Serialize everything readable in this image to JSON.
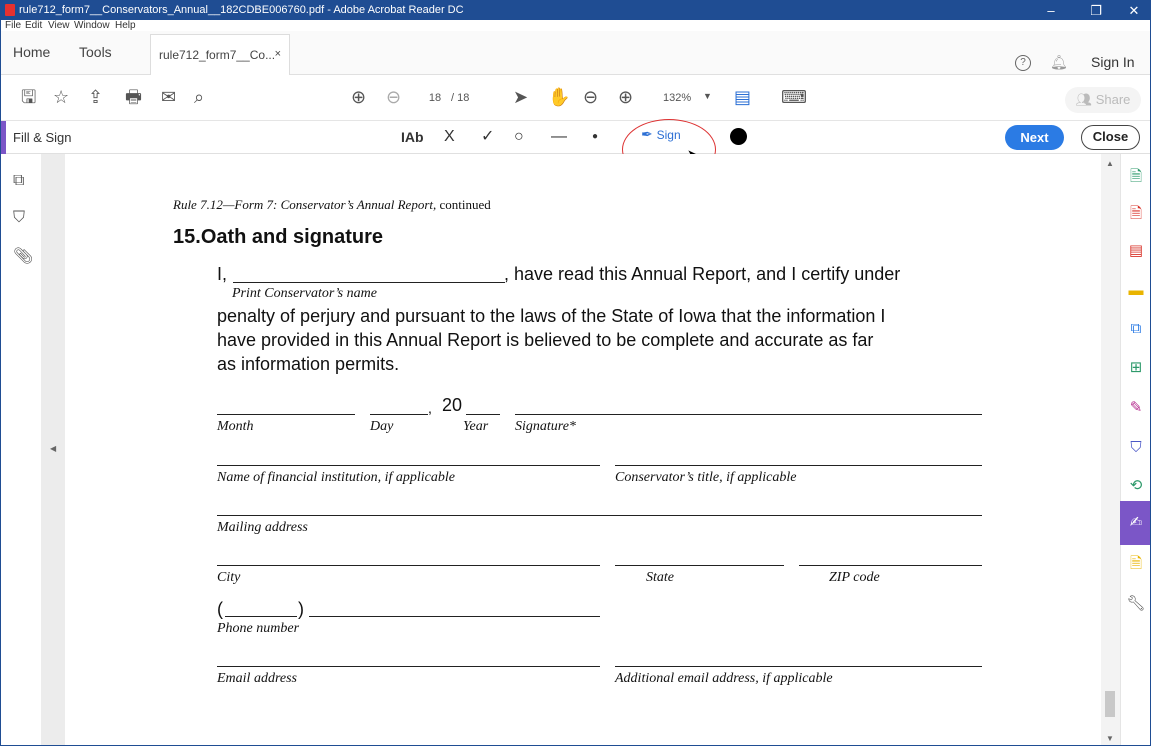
{
  "window": {
    "title": "rule712_form7__Conservators_Annual__182CDBE006760.pdf - Adobe Acrobat Reader DC",
    "minimize": "–",
    "restore": "❐",
    "close": "✕"
  },
  "menu": [
    "File",
    "Edit",
    "View",
    "Window",
    "Help"
  ],
  "tabs": {
    "home": "Home",
    "tools": "Tools",
    "doc_tab": "rule712_form7__Co...",
    "close_glyph": "×"
  },
  "header": {
    "help_glyph": "?",
    "sign_in": "Sign In"
  },
  "toolbar": {
    "page_current": "18",
    "page_total": "/ 18",
    "zoom": "132%",
    "share": "Share"
  },
  "fill_sign": {
    "label": "Fill & Sign",
    "text_tool": "IAb",
    "cross": "X",
    "check": "✓",
    "circle": "○",
    "line": "—",
    "dot": "●",
    "sign": "Sign",
    "next": "Next",
    "close": "Close"
  },
  "doc": {
    "running_head_italic": "Rule 7.12—Form 7: Conservator’s Annual Report,",
    "running_head_rest": " continued",
    "section_num": "15.",
    "section_title": "Oath and signature",
    "p1_start": "I,",
    "p1_end": ", have read this Annual Report, and I certify under",
    "print_name_label": "Print Conservator’s name",
    "p2": "penalty of perjury and pursuant to the laws of the State of Iowa that the information I",
    "p3": "have provided in this Annual Report is believed to be complete and accurate as far",
    "p4": "as information permits.",
    "year_prefix": "20",
    "comma": ",",
    "labels": {
      "month": "Month",
      "day": "Day",
      "year": "Year",
      "signature": "Signature*",
      "financial": "Name of financial institution, if applicable",
      "title": "Conservator’s title, if applicable",
      "mailing": "Mailing address",
      "city": "City",
      "state": "State",
      "zip": "ZIP code",
      "phone": "Phone number",
      "email": "Email address",
      "email2": "Additional email address, if applicable"
    },
    "phone_open": "(",
    "phone_close": ")"
  }
}
